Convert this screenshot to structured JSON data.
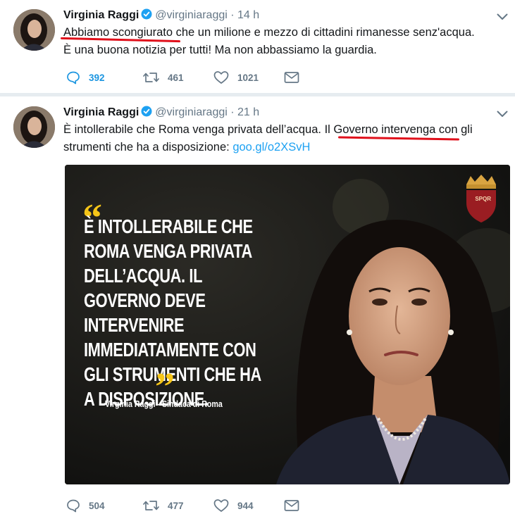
{
  "tweets": [
    {
      "author": "Virginia Raggi",
      "handle": "@virginiaraggi",
      "separator": "·",
      "time": "14 h",
      "text_line1_underlined": "Abbiamo scongiurato",
      "text_line1_rest": " che un milione e mezzo di cittadini rimanesse senz'acqua.",
      "text_line2": "È una buona notizia per tutti! Ma non abbassiamo la guardia.",
      "replies": "392",
      "retweets": "461",
      "likes": "1021"
    },
    {
      "author": "Virginia Raggi",
      "handle": "@virginiaraggi",
      "separator": "·",
      "time": "21 h",
      "text_part1": "È intollerabile che Roma venga privata dell’acqua. ",
      "text_underlined": "Il Governo intervenga",
      "text_part2": " con gli strumenti che ha a disposizione: ",
      "link": "goo.gl/o2XSvH",
      "media": {
        "quote": "È intollerabile che Roma venga privata dell’acqua. Il governo deve intervenire immediatamente con gli strumenti che ha a disposizione.",
        "open_quote": "“",
        "close_quote": "”",
        "caption": "Virginia Raggi - Sindaca di Roma",
        "crest_text": "SPQR"
      },
      "replies": "504",
      "retweets": "477",
      "likes": "944"
    }
  ],
  "colors": {
    "link": "#1da1f2",
    "verified": "#1da1f2",
    "underline": "#e0101b",
    "meta": "#657786",
    "reply_count_blue": "#1b95e0",
    "quote_marks": "#f5c518"
  },
  "icons": [
    "reply-icon",
    "retweet-icon",
    "like-icon",
    "dm-icon",
    "verified-icon",
    "caret-down-icon"
  ]
}
